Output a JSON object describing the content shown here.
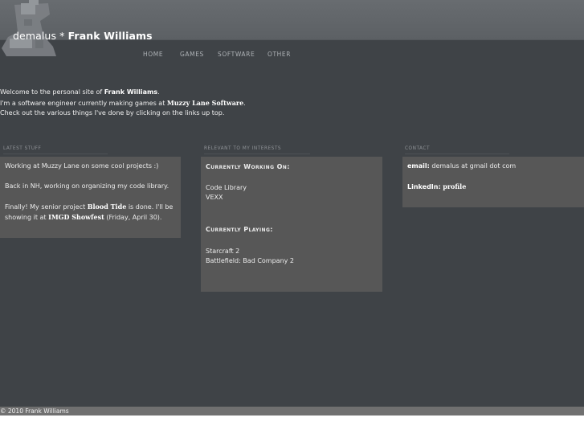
{
  "header": {
    "handle": "demalus",
    "separator": "*",
    "name": "Frank Williams"
  },
  "nav": {
    "items": [
      {
        "label": "HOME"
      },
      {
        "label": "GAMES"
      },
      {
        "label": "SOFTWARE"
      },
      {
        "label": "OTHER"
      }
    ]
  },
  "welcome": {
    "l1_a": "Welcome to the personal site of ",
    "l1_b": "Frank Williams",
    "l1_c": ".",
    "l2_a": "I'm a software engineer currently making games at ",
    "l2_b": "Muzzy Lane Software",
    "l2_c": ".",
    "l3": "Check out the various things I've done by clicking on the links up top."
  },
  "latest": {
    "label": "LATEST STUFF",
    "p1": "Working at Muzzy Lane on some cool projects :)",
    "p2": "Back in NH, working on organizing my code library.",
    "p3_a": "Finally! My senior project ",
    "p3_b": "Blood Tide",
    "p3_c": " is done. I'll be",
    "p4_a": "showing it at ",
    "p4_b": "IMGD Showfest",
    "p4_c": " (Friday, April 30)."
  },
  "interests": {
    "label": "RELEVANT TO MY INTERESTS",
    "working_title": "Currently Working On:",
    "working_items": [
      "Code Library",
      "VEXX"
    ],
    "playing_title": "Currently Playing:",
    "playing_items": [
      "Starcraft 2",
      "Battlefield: Bad Company 2"
    ]
  },
  "contact": {
    "label": "CONTACT",
    "email_label": "email:",
    "email_value": " demalus at gmail dot com",
    "linkedin_label": "LinkedIn:",
    "linkedin_link": "profile"
  },
  "footer": {
    "copyright": "© 2010 Frank Williams"
  }
}
